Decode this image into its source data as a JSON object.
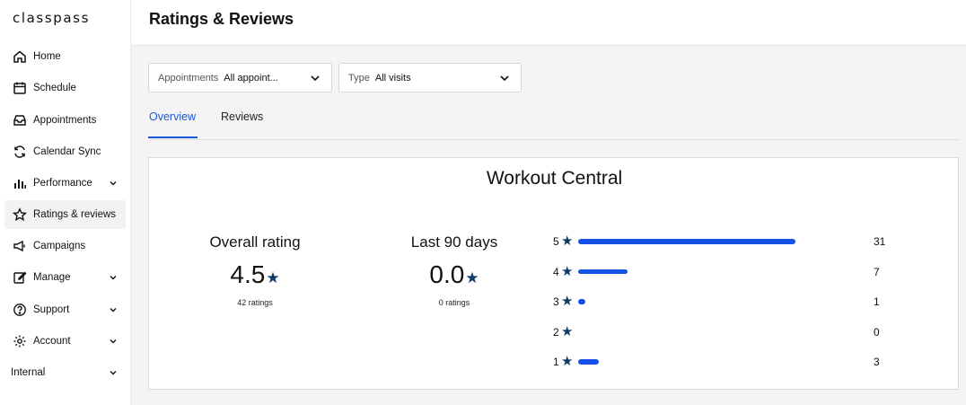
{
  "sidebar": {
    "logo": "classpass",
    "items": [
      {
        "label": "Home"
      },
      {
        "label": "Schedule"
      },
      {
        "label": "Appointments"
      },
      {
        "label": "Calendar Sync"
      },
      {
        "label": "Performance"
      },
      {
        "label": "Ratings & reviews"
      },
      {
        "label": "Campaigns"
      },
      {
        "label": "Manage"
      },
      {
        "label": "Support"
      },
      {
        "label": "Account"
      },
      {
        "label": "Internal"
      }
    ]
  },
  "header": {
    "title": "Ratings & Reviews"
  },
  "filters": {
    "appointments": {
      "label": "Appointments",
      "value": "All appoint..."
    },
    "type": {
      "label": "Type",
      "value": "All visits"
    }
  },
  "tabs": [
    {
      "label": "Overview",
      "active": true
    },
    {
      "label": "Reviews",
      "active": false
    }
  ],
  "card": {
    "studio_name": "Workout Central",
    "overall": {
      "label": "Overall rating",
      "value": "4.5",
      "star": "★",
      "count": "42 ratings"
    },
    "last90": {
      "label": "Last 90 days",
      "value": "0.0",
      "star": "★",
      "count": "0 ratings"
    },
    "distribution": [
      {
        "stars": "5",
        "count": "31",
        "value": 31
      },
      {
        "stars": "4",
        "count": "7",
        "value": 7
      },
      {
        "stars": "3",
        "count": "1",
        "value": 1
      },
      {
        "stars": "2",
        "count": "0",
        "value": 0
      },
      {
        "stars": "1",
        "count": "3",
        "value": 3
      }
    ],
    "star_glyph": "★"
  },
  "colors": {
    "accent": "#1a56db",
    "bar": "#1650e6",
    "star": "#0d3b66"
  }
}
